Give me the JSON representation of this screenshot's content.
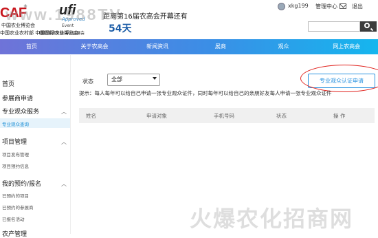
{
  "header": {
    "caf_logo": {
      "mark": "CAF",
      "reg": "®",
      "line1": "中国农业博览会",
      "line2": "中国农业农村部  中国国际农业博览会"
    },
    "ufi_logo": {
      "mark": "ufi",
      "approved": "Approved",
      "event": "Event",
      "subtitle": "国际展览业协会认证展会"
    },
    "countdown_label": "距离第16届农高会开幕还有",
    "countdown_days": "54天",
    "user": {
      "name": "xkg199",
      "center": "管理中心",
      "logout": "退出"
    }
  },
  "nav": [
    "首页",
    "关于农高会",
    "新闻资讯",
    "展商",
    "观众",
    "网上农高会"
  ],
  "sidebar": {
    "home": "首页",
    "exhibitor_apply": "参展商申请",
    "visitor_service": {
      "title": "专业观众服务",
      "items": [
        "专业观众查询"
      ]
    },
    "project_mgmt": {
      "title": "项目管理",
      "items": [
        "项目发布管理",
        "项目预约信息"
      ]
    },
    "my_bookings": {
      "title": "我的预约/报名",
      "items": [
        "已预约的项目",
        "已预约的参展商",
        "已报名活动"
      ]
    },
    "partial_group": "农产管理"
  },
  "main": {
    "filter_label": "状态",
    "status_select_value": "全部",
    "apply_button": "专业观众认证申请",
    "tip": "提示：每人每年可以给自己申请一张专业观众证件，同时每年可以给自己的亲朋好友每人申请一张专业观众证件",
    "table_headers": [
      "姓名",
      "申请对象",
      "手机号码",
      "状态",
      "操 作"
    ]
  },
  "watermarks": {
    "top": "www.1988TV",
    "bottom": "火爆农化招商网"
  },
  "colors": {
    "accent": "#2a93e0",
    "countdown": "#1f5fa8",
    "brand_red": "#c8161d",
    "annotation_ring": "#e0201b"
  }
}
